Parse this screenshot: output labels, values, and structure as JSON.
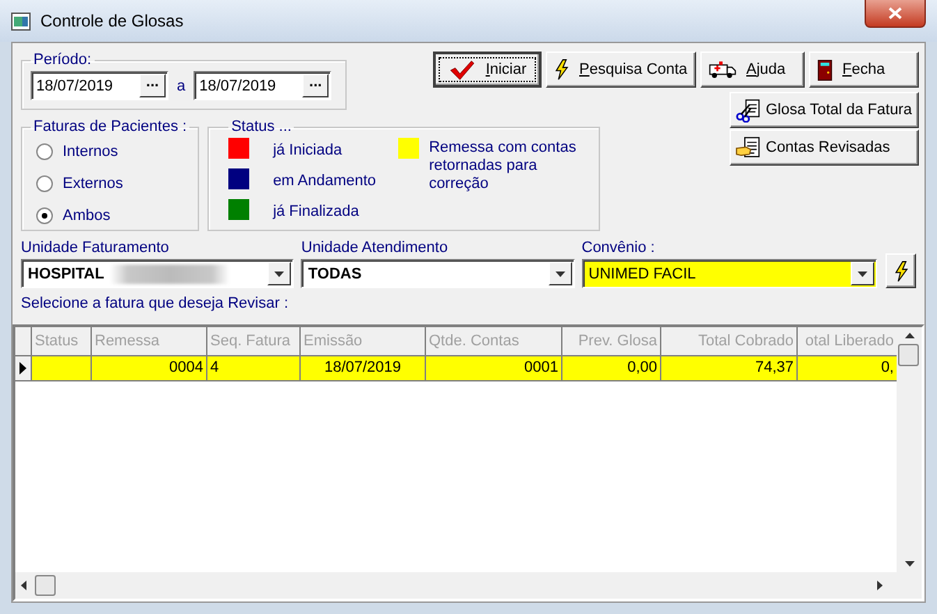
{
  "window": {
    "title": "Controle de Glosas"
  },
  "periodo": {
    "label": "Período:",
    "from": "18/07/2019",
    "separator": "a",
    "to": "18/07/2019",
    "picker": "..."
  },
  "buttons": [
    {
      "label": "Iniciar",
      "kind": "check",
      "focused": true
    },
    {
      "label": "Pesquisa Conta",
      "kind": "lightning",
      "focused": false
    },
    {
      "label": "Ajuda",
      "kind": "ambulance",
      "focused": false
    },
    {
      "label": "Fecha",
      "kind": "door",
      "focused": false
    }
  ],
  "side_buttons": [
    {
      "label": "Glosa Total da Fatura",
      "kind": "scissors"
    },
    {
      "label": "Contas Revisadas",
      "kind": "hand"
    }
  ],
  "faturas": {
    "title": "Faturas de Pacientes :",
    "options": [
      {
        "label": "Internos",
        "selected": false
      },
      {
        "label": "Externos",
        "selected": false
      },
      {
        "label": "Ambos",
        "selected": true
      }
    ]
  },
  "status_legend": {
    "title": "Status ...",
    "items": [
      {
        "label": "já Iniciada",
        "color": "#ff0000"
      },
      {
        "label": "em Andamento",
        "color": "#000080"
      },
      {
        "label": "já Finalizada",
        "color": "#008000"
      },
      {
        "label": "Remessa com contas retornadas para correção",
        "color": "#ffff00"
      }
    ]
  },
  "filters": [
    {
      "label": "Unidade Faturamento",
      "value": "HOSPITAL",
      "redacted": true,
      "highlighted": false
    },
    {
      "label": "Unidade Atendimento",
      "value": "TODAS",
      "redacted": false,
      "highlighted": false
    },
    {
      "label": "Convênio :",
      "value": "UNIMED FACIL",
      "redacted": false,
      "highlighted": true
    }
  ],
  "prompt": "Selecione a fatura que deseja Revisar :",
  "table": {
    "columns": [
      "Status",
      "Remessa",
      "Seq. Fatura",
      "Emissão",
      "Qtde. Contas",
      "Prev. Glosa",
      "Total Cobrado",
      "otal Liberado"
    ],
    "rows": [
      {
        "selected": true,
        "cells": [
          "",
          "0004",
          "4",
          "18/07/2019",
          "0001",
          "0,00",
          "74,37",
          "0,"
        ]
      }
    ]
  }
}
